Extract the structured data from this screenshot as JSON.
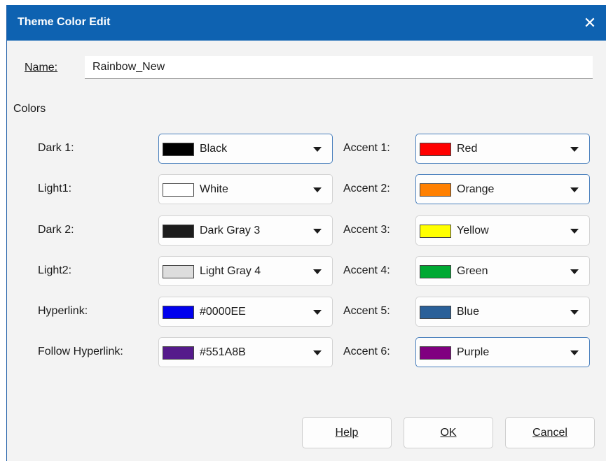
{
  "window": {
    "title": "Theme Color Edit",
    "close_glyph": "✕"
  },
  "name": {
    "label": "Name:",
    "value": "Rainbow_New"
  },
  "colors_heading": "Colors",
  "left_rows": [
    {
      "label": "Dark 1:",
      "value": "Black",
      "color": "#000000"
    },
    {
      "label": "Light1:",
      "value": "White",
      "color": "#ffffff"
    },
    {
      "label": "Dark 2:",
      "value": "Dark Gray 3",
      "color": "#1c1c1c"
    },
    {
      "label": "Light2:",
      "value": "Light Gray 4",
      "color": "#dddddd"
    },
    {
      "label": "Hyperlink:",
      "value": "#0000EE",
      "color": "#0000ee"
    },
    {
      "label": "Follow Hyperlink:",
      "value": "#551A8B",
      "color": "#551a8b"
    }
  ],
  "right_rows": [
    {
      "label": "Accent 1:",
      "value": "Red",
      "color": "#ff0000"
    },
    {
      "label": "Accent 2:",
      "value": "Orange",
      "color": "#ff8000"
    },
    {
      "label": "Accent 3:",
      "value": "Yellow",
      "color": "#ffff00"
    },
    {
      "label": "Accent 4:",
      "value": "Green",
      "color": "#00a933"
    },
    {
      "label": "Accent 5:",
      "value": "Blue",
      "color": "#2a6099"
    },
    {
      "label": "Accent 6:",
      "value": "Purple",
      "color": "#800080"
    }
  ],
  "buttons": {
    "help": "Help",
    "ok": "OK",
    "cancel": "Cancel"
  }
}
